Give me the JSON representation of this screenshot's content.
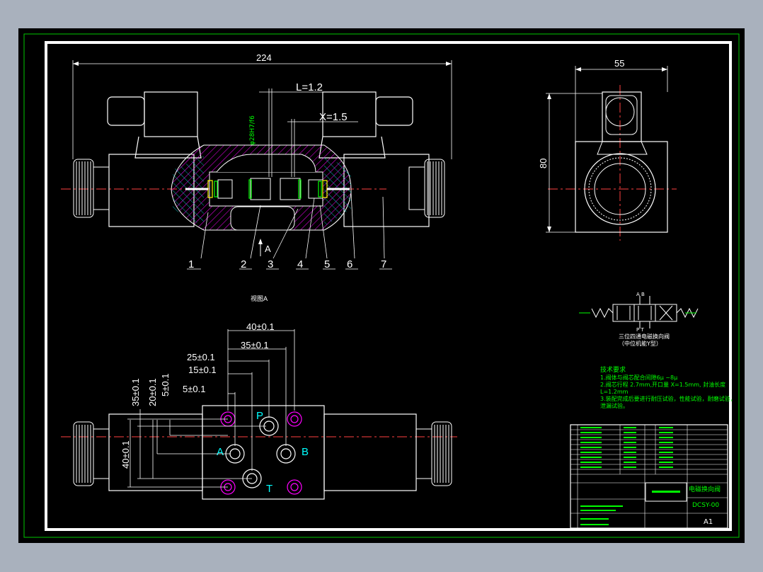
{
  "drawing": {
    "dimensions": {
      "overall_length": "224",
      "gap_L": "L=1.2",
      "gap_X": "X=1.5",
      "side_width": "55",
      "side_height": "80",
      "fit_note": "φ28H7/f6",
      "d40": "40±0.1",
      "d35": "35±0.1",
      "d25": "25±0.1",
      "d15": "15±0.1",
      "d5": "5±0.1",
      "v35": "35±0.1",
      "v20": "20±0.1",
      "v5": "5±0.1",
      "v40": "40±0.1"
    },
    "part_numbers": [
      "1",
      "2",
      "3",
      "4",
      "5",
      "6",
      "7"
    ],
    "ports": {
      "p": "P",
      "a": "A",
      "b": "B",
      "t": "T"
    },
    "view_label": "视图A",
    "arrow_label": "A",
    "symbol": {
      "top_ports": "A  B",
      "bottom_ports": "P  T",
      "caption_line1": "三位四通电磁换向阀",
      "caption_line2": "（中位机能Y型）"
    },
    "tech_requirements": {
      "heading": "技术要求",
      "lines": [
        "1.阀体与阀芯配合间隙6μ ~8μ",
        "2.阀芯行程 2.7mm,开口量 X=1.5mm, 封油长度",
        "L=1.2mm",
        "3.装配完成后要进行耐压试验，性能试验，耐磨试验，",
        "  泄漏试验。"
      ]
    },
    "title_block": {
      "drawing_title": "电磁换向阀",
      "drawing_number": "DCSY-00",
      "sheet_size": "A1"
    }
  }
}
